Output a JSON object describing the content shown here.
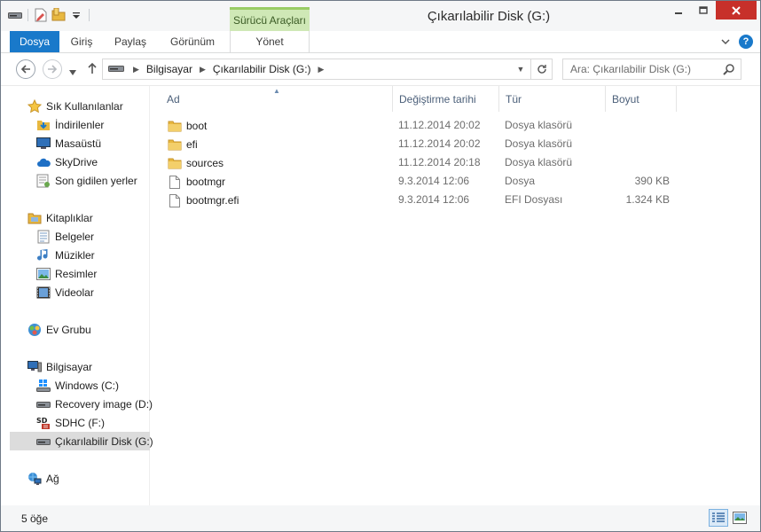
{
  "window": {
    "title": "Çıkarılabilir Disk (G:)",
    "contextual_group": "Sürücü Araçları"
  },
  "qat": {
    "icons": [
      "properties-icon",
      "new-folder-icon",
      "customize-qat-icon"
    ]
  },
  "ribbon": {
    "tabs": [
      {
        "id": "file",
        "label": "Dosya"
      },
      {
        "id": "home",
        "label": "Giriş"
      },
      {
        "id": "share",
        "label": "Paylaş"
      },
      {
        "id": "view",
        "label": "Görünüm"
      },
      {
        "id": "manage",
        "label": "Yönet"
      }
    ]
  },
  "address": {
    "segments": [
      "Bilgisayar",
      "Çıkarılabilir Disk (G:)"
    ]
  },
  "search": {
    "placeholder": "Ara: Çıkarılabilir Disk (G:)"
  },
  "sidebar": {
    "favorites": {
      "label": "Sık Kullanılanlar",
      "items": [
        "İndirilenler",
        "Masaüstü",
        "SkyDrive",
        "Son gidilen yerler"
      ]
    },
    "libraries": {
      "label": "Kitaplıklar",
      "items": [
        "Belgeler",
        "Müzikler",
        "Resimler",
        "Videolar"
      ]
    },
    "homegroup": {
      "label": "Ev Grubu"
    },
    "computer": {
      "label": "Bilgisayar",
      "items": [
        "Windows (C:)",
        "Recovery image (D:)",
        "SDHC (F:)",
        "Çıkarılabilir Disk (G:)"
      ],
      "selected": "Çıkarılabilir Disk (G:)"
    },
    "network": {
      "label": "Ağ"
    }
  },
  "columns": {
    "name": "Ad",
    "date": "Değiştirme tarihi",
    "type": "Tür",
    "size": "Boyut"
  },
  "files": [
    {
      "name": "boot",
      "date": "11.12.2014 20:02",
      "type": "Dosya klasörü",
      "size": "",
      "icon": "folder"
    },
    {
      "name": "efi",
      "date": "11.12.2014 20:02",
      "type": "Dosya klasörü",
      "size": "",
      "icon": "folder"
    },
    {
      "name": "sources",
      "date": "11.12.2014 20:18",
      "type": "Dosya klasörü",
      "size": "",
      "icon": "folder"
    },
    {
      "name": "bootmgr",
      "date": "9.3.2014 12:06",
      "type": "Dosya",
      "size": "390 KB",
      "icon": "file"
    },
    {
      "name": "bootmgr.efi",
      "date": "9.3.2014 12:06",
      "type": "EFI Dosyası",
      "size": "1.324 KB",
      "icon": "file"
    }
  ],
  "status": {
    "count": "5 öğe"
  },
  "colors": {
    "accent": "#1979ca",
    "close": "#c7302a",
    "contextual": "#cfe8b6",
    "folder": "#e8b840"
  }
}
